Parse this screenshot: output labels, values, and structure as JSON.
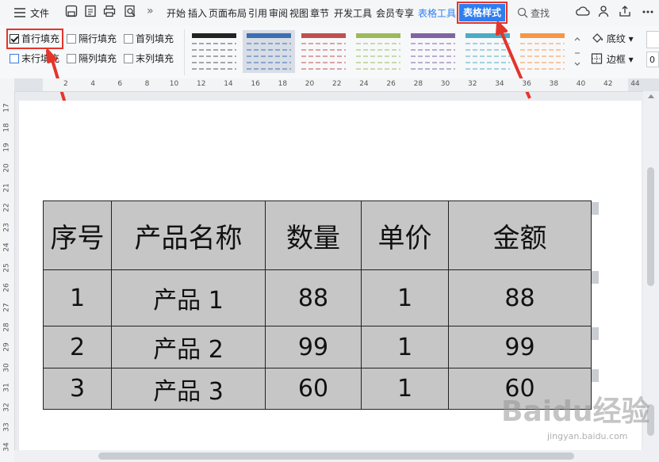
{
  "menubar": {
    "file_label": "文件",
    "more_label": "»",
    "tabs": [
      "开始",
      "插入",
      "页面布局",
      "引用",
      "审阅",
      "视图",
      "章节",
      "开发工具",
      "会员专享",
      "表格工具",
      "表格样式"
    ],
    "active_tab": "表格样式",
    "search_label": "查找"
  },
  "ribbon": {
    "options": [
      {
        "label": "首行填充",
        "checked": true
      },
      {
        "label": "隔行填充",
        "checked": false
      },
      {
        "label": "首列填充",
        "checked": false
      },
      {
        "label": "末行填充",
        "checked": false
      },
      {
        "label": "隔列填充",
        "checked": false
      },
      {
        "label": "末列填充",
        "checked": false
      }
    ],
    "shading_label": "底纹",
    "border_label": "边框",
    "style_colors": [
      "#222222",
      "#3a6fb5",
      "#c0504d",
      "#9bbb59",
      "#8064a2",
      "#4bacc6",
      "#f79646"
    ]
  },
  "ruler": {
    "horizontal": [
      "2",
      "4",
      "6",
      "8",
      "10",
      "12",
      "14",
      "16",
      "18",
      "20",
      "22",
      "24",
      "26",
      "28",
      "30",
      "32",
      "34",
      "36",
      "38",
      "40",
      "42",
      "44"
    ],
    "vertical": [
      "17",
      "18",
      "19",
      "20",
      "21",
      "22",
      "23",
      "24",
      "25",
      "26",
      "27",
      "28",
      "29",
      "30",
      "31",
      "32",
      "33",
      "34"
    ]
  },
  "table": {
    "headers": [
      "序号",
      "产品名称",
      "数量",
      "单价",
      "金额"
    ],
    "rows": [
      [
        "1",
        "产品 1",
        "88",
        "1",
        "88"
      ],
      [
        "2",
        "产品 2",
        "99",
        "1",
        "99"
      ],
      [
        "3",
        "产品 3",
        "60",
        "1",
        "60"
      ]
    ]
  },
  "watermark": {
    "text": "Baidu经验",
    "url": "jingyan.baidu.com"
  }
}
